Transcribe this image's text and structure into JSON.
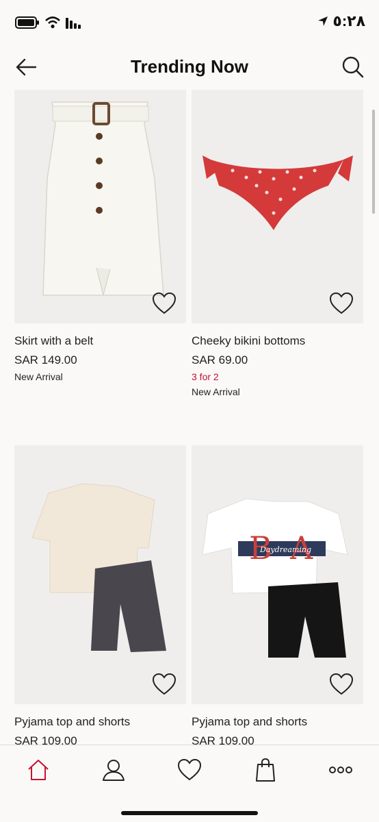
{
  "status_bar": {
    "time": "٥:٢٨"
  },
  "header": {
    "title": "Trending Now"
  },
  "products": [
    {
      "name": "Skirt with a belt",
      "price": "SAR 149.00",
      "promo": "",
      "badge": "New Arrival"
    },
    {
      "name": "Cheeky bikini bottoms",
      "price": "SAR 69.00",
      "promo": "3 for 2",
      "badge": "New Arrival"
    },
    {
      "name": "Pyjama top and shorts",
      "price": "SAR 109.00",
      "promo": "",
      "badge": ""
    },
    {
      "name": "Pyjama top and shorts",
      "price": "SAR 109.00",
      "promo": "",
      "badge": ""
    }
  ],
  "print_text": {
    "letters_left": "B",
    "letters_right": "A",
    "script": "Daydreaming"
  },
  "tabbar": {
    "icons": [
      "home-icon",
      "account-icon",
      "favourites-icon",
      "bag-icon",
      "more-icon"
    ],
    "active": "home-icon"
  },
  "colors": {
    "accent": "#c8102e",
    "background": "#faf9f8"
  }
}
